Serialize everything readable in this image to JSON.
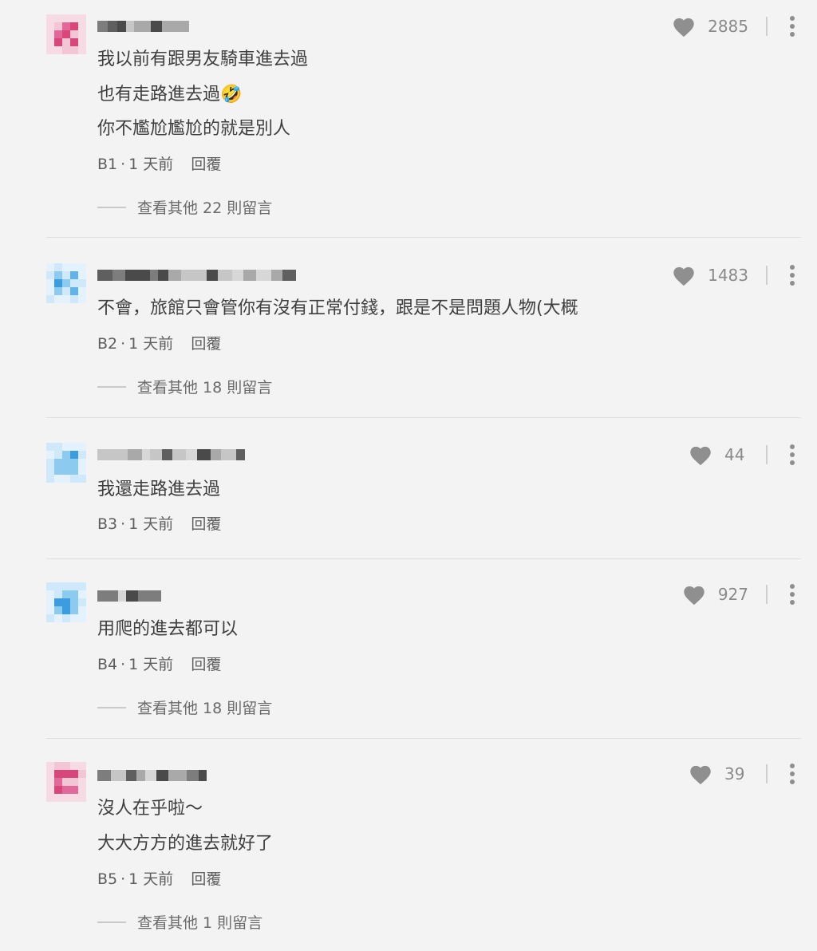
{
  "colors": {
    "background": "#f3f3f4",
    "text": "#3e3e3e",
    "meta": "#5e5e5e",
    "icon": "#8f8f8f",
    "avatar_pink": "#d9477a",
    "avatar_blue": "#3b9ddd"
  },
  "icons": {
    "like": "heart-icon",
    "more": "vertical-ellipsis-icon"
  },
  "comments": [
    {
      "lines": [
        "我以前有跟男友騎車進去過",
        "也有走路進去過",
        "你不尷尬尷尬的就是別人"
      ],
      "emoji": "🤣",
      "floor": "B1",
      "time": "1 天前",
      "reply": "回覆",
      "likes": "2885",
      "more_replies": "查看其他 22 則留言"
    },
    {
      "lines": [
        "不會，旅館只會管你有沒有正常付錢，跟是不是問題人物(大概"
      ],
      "floor": "B2",
      "time": "1 天前",
      "reply": "回覆",
      "likes": "1483",
      "more_replies": "查看其他 18 則留言"
    },
    {
      "lines": [
        "我還走路進去過"
      ],
      "floor": "B3",
      "time": "1 天前",
      "reply": "回覆",
      "likes": "44"
    },
    {
      "lines": [
        "用爬的進去都可以"
      ],
      "floor": "B4",
      "time": "1 天前",
      "reply": "回覆",
      "likes": "927",
      "more_replies": "查看其他 18 則留言"
    },
    {
      "lines": [
        "沒人在乎啦～",
        "大大方方的進去就好了"
      ],
      "floor": "B5",
      "time": "1 天前",
      "reply": "回覆",
      "likes": "39",
      "more_replies": "查看其他 1 則留言"
    }
  ]
}
